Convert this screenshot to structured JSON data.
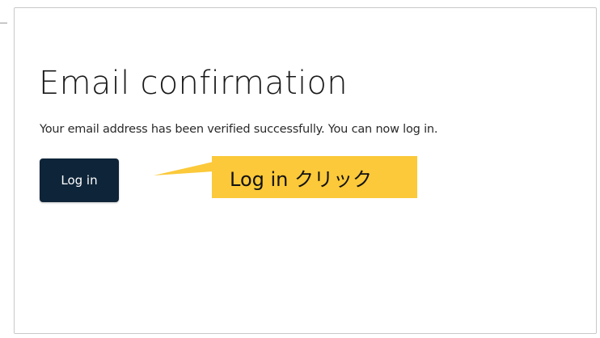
{
  "card": {
    "title": "Email confirmation",
    "message": "Your email address has been verified successfully. You can now log in.",
    "login_button_label": "Log in"
  },
  "annotation": {
    "callout_text": "Log in クリック",
    "callout_color": "#fbc93a",
    "arrow_color": "#e0191b"
  },
  "colors": {
    "button_bg": "#0e2438",
    "border": "#c9c9c9"
  }
}
